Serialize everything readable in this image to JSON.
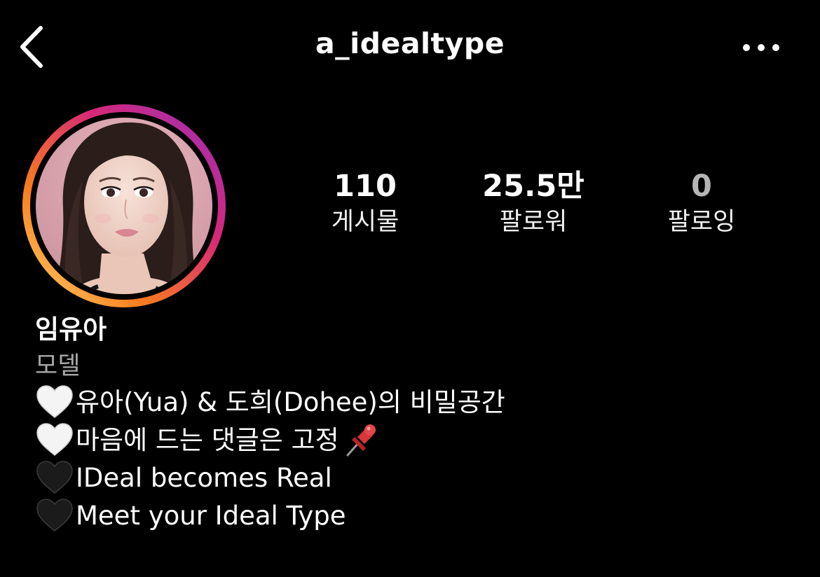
{
  "header": {
    "username": "a_idealtype",
    "back_icon": "chevron-left-icon",
    "more_icon": "more-horizontal-icon"
  },
  "profile": {
    "avatar_icon": "profile-photo",
    "story_ring_colors": [
      "#feda75",
      "#fa7e1e",
      "#d62976",
      "#962fbf"
    ]
  },
  "stats": [
    {
      "value": "110",
      "label": "게시물"
    },
    {
      "value": "25.5만",
      "label": "팔로워"
    },
    {
      "value": "0",
      "label": "팔로잉"
    }
  ],
  "bio": {
    "name": "임유아",
    "category": "모델",
    "lines": [
      {
        "icon": "white-heart-icon",
        "text": "유아(Yua) & 도희(Dohee)의 비밀공간"
      },
      {
        "icon": "white-heart-icon",
        "text": "마음에 드는 댓글은 고정",
        "trailing_icon": "pushpin-icon"
      },
      {
        "icon": "black-heart-icon",
        "text": "IDeal becomes Real"
      },
      {
        "icon": "black-heart-icon",
        "text": "Meet your Ideal Type"
      }
    ]
  }
}
